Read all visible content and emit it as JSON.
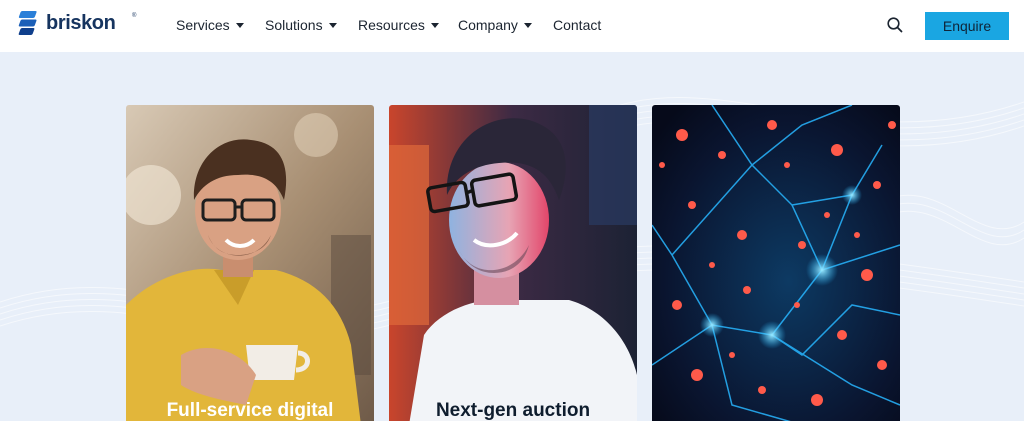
{
  "brand": {
    "name": "briskon",
    "reg": "®"
  },
  "nav": {
    "items": [
      {
        "label": "Services",
        "dropdown": true
      },
      {
        "label": "Solutions",
        "dropdown": true
      },
      {
        "label": "Resources",
        "dropdown": true
      },
      {
        "label": "Company",
        "dropdown": true
      },
      {
        "label": "Contact",
        "dropdown": false
      }
    ],
    "search_icon": "search-icon",
    "enquire_label": "Enquire"
  },
  "cards": [
    {
      "title": "Full-service digital",
      "title_color": "#ffffff"
    },
    {
      "title": "Next-gen auction",
      "title_color": "#0f1d2e"
    },
    {
      "title": "",
      "title_color": "#ffffff"
    }
  ],
  "colors": {
    "accent": "#1aa6e2",
    "brand_navy": "#16345f",
    "background": "#e8eff9"
  }
}
